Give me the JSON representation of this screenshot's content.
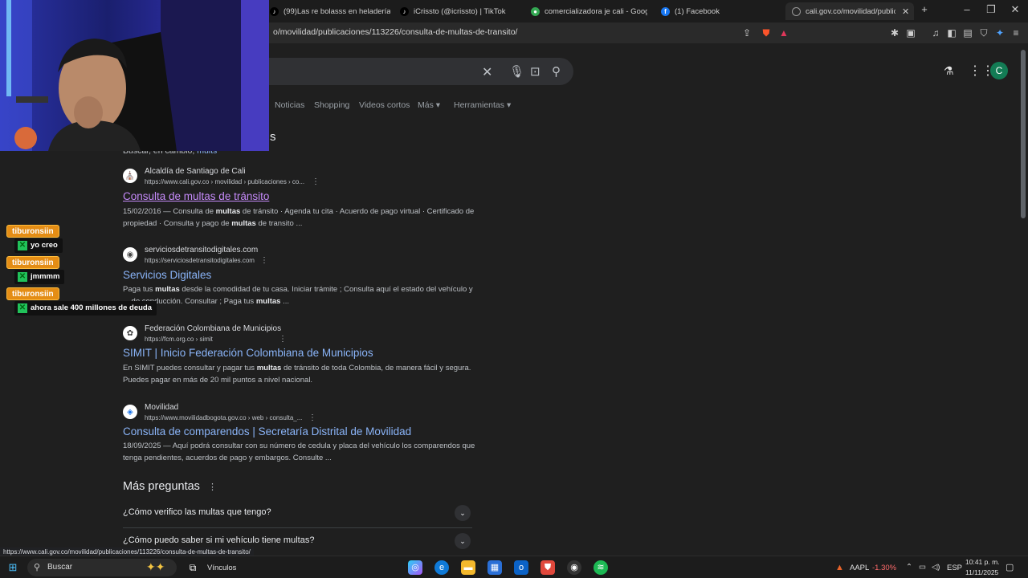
{
  "browser": {
    "tabs": [
      {
        "label": "(99)Las re bolasss en heladería ✨ C...",
        "icon": "tiktok-icon"
      },
      {
        "label": "iCrissto (@icrissto) | TikTok",
        "icon": "tiktok-icon"
      },
      {
        "label": "comercializadora je cali - Google Ma...",
        "icon": "maps-icon"
      },
      {
        "label": "(1) Facebook",
        "icon": "facebook-icon"
      },
      {
        "label": "cali.gov.co/movilidad/publicacio...",
        "icon": "web-icon",
        "active": true
      }
    ],
    "url": "o/movilidad/publicaciones/113226/consulta-de-multas-de-transito/"
  },
  "search": {
    "filters": [
      "Noticias",
      "Shopping",
      "Videos cortos",
      "Más",
      "Herramientas"
    ],
    "partial_heading": "s",
    "search_instead_prefix": "Buscar, en cambio,",
    "search_instead_link": "mults",
    "avatar_letter": "C"
  },
  "results": [
    {
      "site": "Alcaldía de Santiago de Cali",
      "crumb": "https://www.cali.gov.co › movilidad › publicaciones › co...",
      "title": "Consulta de multas de tránsito",
      "snippet_parts": [
        "15/02/2016 — Consulta de ",
        "multas",
        " de tránsito · Agenda tu cita · Acuerdo de pago virtual · Certificado de propiedad · Consulta y pago de ",
        "multas",
        " de transito ..."
      ]
    },
    {
      "site": "serviciosdetransitodigitales.com",
      "crumb": "https://serviciosdetransitodigitales.com",
      "title": "Servicios Digitales",
      "snippet_parts": [
        "Paga tus ",
        "multas",
        " desde la comodidad de tu casa. Iniciar trámite ; Consulta aquí el estado del vehículo y ... de conducción. Consultar ; Paga tus ",
        "multas",
        " ..."
      ]
    },
    {
      "site": "Federación Colombiana de Municipios",
      "crumb": "https://fcm.org.co › simit",
      "title": "SIMIT | Inicio Federación Colombiana de Municipios",
      "snippet_parts": [
        "En SIMIT puedes consultar y pagar tus ",
        "multas",
        " de tránsito de toda Colombia, de manera fácil y segura. Puedes pagar en más de 20 mil puntos a nivel nacional.",
        "",
        ""
      ]
    },
    {
      "site": "Movilidad",
      "crumb": "https://www.movilidadbogota.gov.co › web › consulta_...",
      "title": "Consulta de comparendos | Secretaría Distrital de Movilidad",
      "snippet_parts": [
        "18/09/2025 — Aquí podrá consultar con su número de cedula y placa del vehículo los comparendos que tenga pendientes, acuerdos de pago y embargos. Consulte ...",
        "",
        "",
        "",
        ""
      ]
    }
  ],
  "paa": {
    "title": "Más preguntas",
    "questions": [
      "¿Cómo verifico las multas que tengo?",
      "¿Cómo puedo saber si mi vehículo tiene multas?"
    ]
  },
  "chat": [
    {
      "user": "tiburonsiin",
      "message": "yo creo"
    },
    {
      "user": "tiburonsiin",
      "message": "jmmmm"
    },
    {
      "user": "tiburonsiin",
      "message": "ahora sale 400 millones de deuda"
    }
  ],
  "status_url": "https://www.cali.gov.co/movilidad/publicaciones/113226/consulta-de-multas-de-transito/",
  "taskbar": {
    "search_label": "Buscar",
    "vinculos_label": "Vínculos",
    "stock_symbol": "AAPL",
    "stock_change": "-1.30%",
    "language": "ESP",
    "time": "10:41 p. m.",
    "date": "11/11/2025"
  }
}
